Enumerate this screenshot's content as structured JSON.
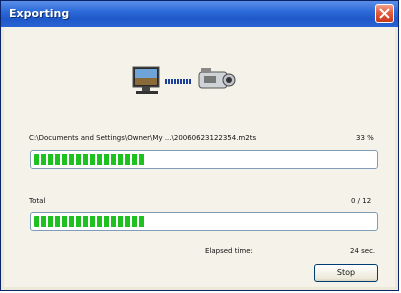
{
  "window": {
    "title": "Exporting"
  },
  "icons": {
    "close": "close-icon",
    "computer": "computer-icon",
    "transfer": "transfer-dots-icon",
    "camcorder": "camcorder-icon"
  },
  "file": {
    "path": "C:\\Documents and Settings\\Owner\\My ...\\20060623122354.m2ts",
    "percent": "33 %",
    "progress": 0.33
  },
  "total": {
    "label": "Total",
    "count": "0 / 12",
    "progress": 0.33
  },
  "elapsed": {
    "label": "Elapsed time:",
    "value": "24 sec."
  },
  "buttons": {
    "stop": "Stop"
  },
  "colors": {
    "progress": "#1ec21e",
    "titlebar": "#2d6ad9"
  }
}
